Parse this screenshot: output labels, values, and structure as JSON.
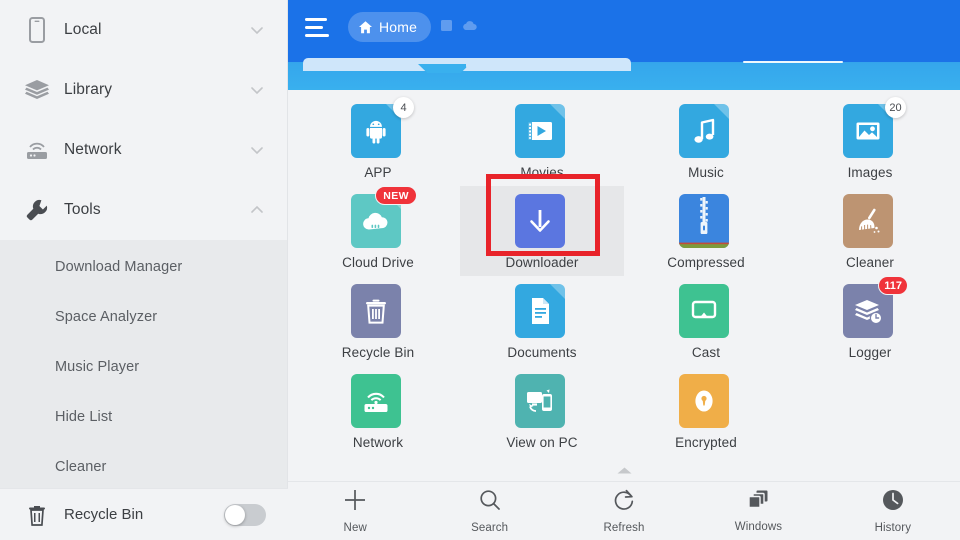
{
  "sidebar": {
    "groups": [
      {
        "label": "Local",
        "icon": "phone-icon",
        "expanded": false
      },
      {
        "label": "Library",
        "icon": "layers-icon",
        "expanded": false
      },
      {
        "label": "Network",
        "icon": "router-icon",
        "expanded": false
      },
      {
        "label": "Tools",
        "icon": "wrench-icon",
        "expanded": true
      }
    ],
    "tools_items": [
      {
        "label": "Download Manager"
      },
      {
        "label": "Space Analyzer"
      },
      {
        "label": "Music Player"
      },
      {
        "label": "Hide List"
      },
      {
        "label": "Cleaner"
      }
    ],
    "bottom": {
      "label": "Recycle Bin",
      "icon": "trash-icon",
      "toggle_state": "off"
    }
  },
  "header": {
    "menu_icon": "hamburger-icon",
    "breadcrumb": "Home",
    "home_icon": "home-icon",
    "extra_icons": [
      "tag-icon",
      "cloud-icon"
    ],
    "accent_color": "#1b72e8",
    "band_color": "#39b0ee"
  },
  "grid": {
    "items": [
      {
        "label": "APP",
        "icon": "android-icon",
        "color": "#33a8e0",
        "badge": "4",
        "badge_type": "count",
        "selected": false
      },
      {
        "label": "Movies",
        "icon": "video-icon",
        "color": "#33a8e0",
        "badge": "",
        "badge_type": "none",
        "selected": false
      },
      {
        "label": "Music",
        "icon": "music-note-icon",
        "color": "#33a8e0",
        "badge": "",
        "badge_type": "none",
        "selected": false
      },
      {
        "label": "Images",
        "icon": "photo-icon",
        "color": "#33a8e0",
        "badge": "20",
        "badge_type": "count",
        "selected": false
      },
      {
        "label": "Cloud Drive",
        "icon": "cloud-icon",
        "color": "#5ec8c4",
        "badge": "NEW",
        "badge_type": "new",
        "selected": false
      },
      {
        "label": "Downloader",
        "icon": "download-icon",
        "color": "#5b76e0",
        "badge": "",
        "badge_type": "none",
        "selected": true
      },
      {
        "label": "Compressed",
        "icon": "zip-icon",
        "color": "#3b85de",
        "badge": "",
        "badge_type": "none",
        "selected": false
      },
      {
        "label": "Cleaner",
        "icon": "broom-icon",
        "color": "#bd9472",
        "badge": "",
        "badge_type": "none",
        "selected": false
      },
      {
        "label": "Recycle Bin",
        "icon": "trash-icon",
        "color": "#7b82ab",
        "badge": "",
        "badge_type": "none",
        "selected": false
      },
      {
        "label": "Documents",
        "icon": "document-icon",
        "color": "#33a8e0",
        "badge": "",
        "badge_type": "none",
        "selected": false
      },
      {
        "label": "Cast",
        "icon": "cast-icon",
        "color": "#3ec291",
        "badge": "",
        "badge_type": "none",
        "selected": false
      },
      {
        "label": "Logger",
        "icon": "logger-icon",
        "color": "#7b82ab",
        "badge": "117",
        "badge_type": "red",
        "selected": false
      },
      {
        "label": "Network",
        "icon": "router-icon",
        "color": "#3ec291",
        "badge": "",
        "badge_type": "none",
        "selected": false
      },
      {
        "label": "View on PC",
        "icon": "pc-sync-icon",
        "color": "#4fb3b0",
        "badge": "",
        "badge_type": "none",
        "selected": false
      },
      {
        "label": "Encrypted",
        "icon": "lock-icon",
        "color": "#f0ae48",
        "badge": "",
        "badge_type": "none",
        "selected": false
      }
    ],
    "highlight": {
      "target": "Downloader",
      "color": "#e8232a"
    }
  },
  "bottombar": {
    "collapse_icon": "chevron-up-icon",
    "items": [
      {
        "label": "New",
        "icon": "plus-icon"
      },
      {
        "label": "Search",
        "icon": "search-icon"
      },
      {
        "label": "Refresh",
        "icon": "refresh-icon"
      },
      {
        "label": "Windows",
        "icon": "windows-stack-icon"
      },
      {
        "label": "History",
        "icon": "clock-icon"
      }
    ]
  }
}
